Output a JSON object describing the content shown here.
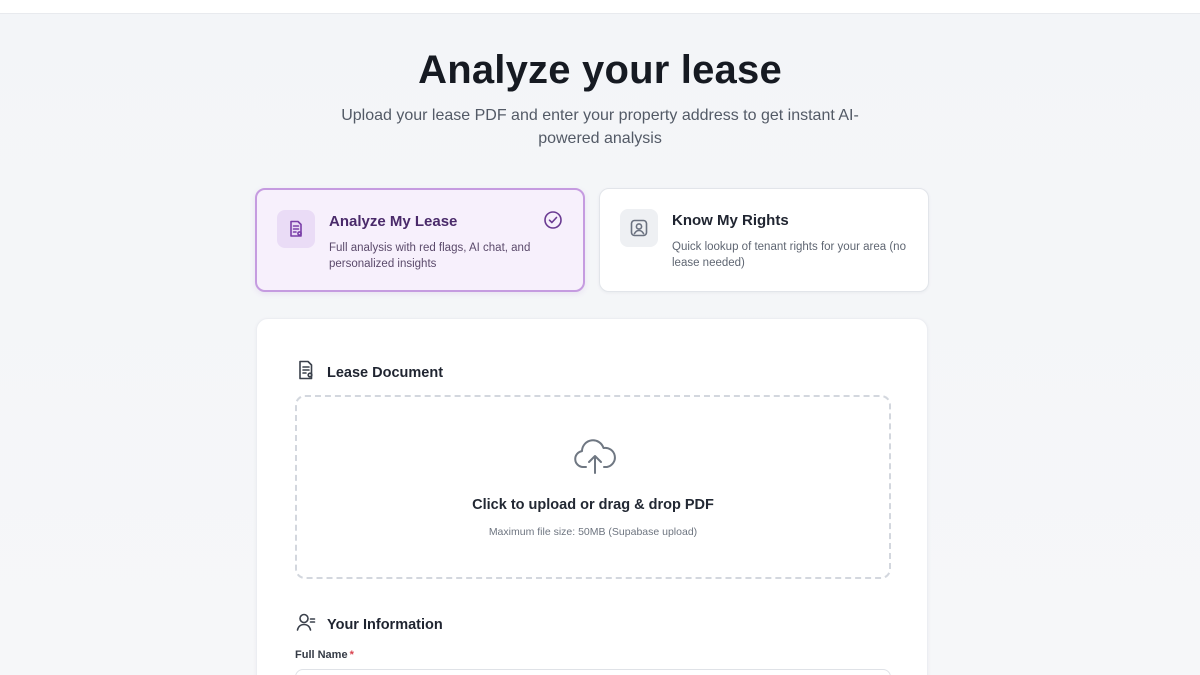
{
  "watermark": "",
  "header": {
    "title": "Analyze your lease",
    "subtitle": "Upload your lease PDF and enter your property address to get instant AI-powered analysis"
  },
  "modes": [
    {
      "title": "Analyze My Lease",
      "description": "Full analysis with red flags, AI chat, and personalized insights",
      "icon": "document-icon",
      "selected": true
    },
    {
      "title": "Know My Rights",
      "description": "Quick lookup of tenant rights for your area (no lease needed)",
      "icon": "location-pin-icon",
      "selected": false
    }
  ],
  "lease_document": {
    "heading": "Lease Document",
    "upload_title": "Click to upload or drag & drop PDF",
    "upload_subtitle": "Maximum file size: 50MB (Supabase upload)"
  },
  "your_information": {
    "heading": "Your Information",
    "full_name_label": "Full Name",
    "required_marker": "*",
    "full_name_value": ""
  },
  "colors": {
    "accent_purple": "#c59be0",
    "accent_bg": "#f7f0fc",
    "required": "#d9434f"
  }
}
